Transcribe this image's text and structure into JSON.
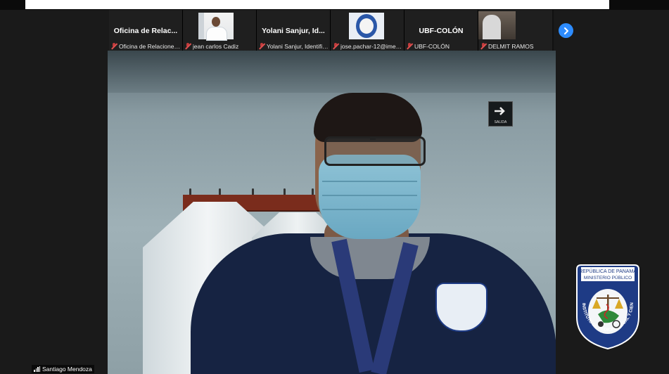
{
  "tiles": [
    {
      "display_name": "Oficina de Relac...",
      "label": "Oficina de Relaciones..."
    },
    {
      "display_name": "",
      "label": "jean carlos Cadiz"
    },
    {
      "display_name": "Yolani Sanjur, Id...",
      "label": "Yolani Sanjur, Identific..."
    },
    {
      "display_name": "",
      "label": "jose.pachar-12@imelc..."
    },
    {
      "display_name": "UBF-COLÓN",
      "label": "UBF-COLÓN"
    },
    {
      "display_name": "",
      "label": "DELMIT RAMOS"
    }
  ],
  "main": {
    "speaker_name": "Santiago Mendoza",
    "sign_text": "SALIDA"
  },
  "logo": {
    "top_line1": "REPÚBLICA DE PANAMÁ",
    "top_line2": "MINISTERIO PÚBLICO",
    "ring_text": "INSTITUTO DE MEDICINA LEGAL Y CIENCIAS FORENSES"
  },
  "colors": {
    "accent": "#2d8cff",
    "muted_mic": "#c23b3b",
    "logo_blue": "#1e3b85"
  },
  "icons": {
    "next_button": "chevron-right-icon",
    "mic": "mic-muted-icon",
    "signal": "signal-bars-icon"
  }
}
